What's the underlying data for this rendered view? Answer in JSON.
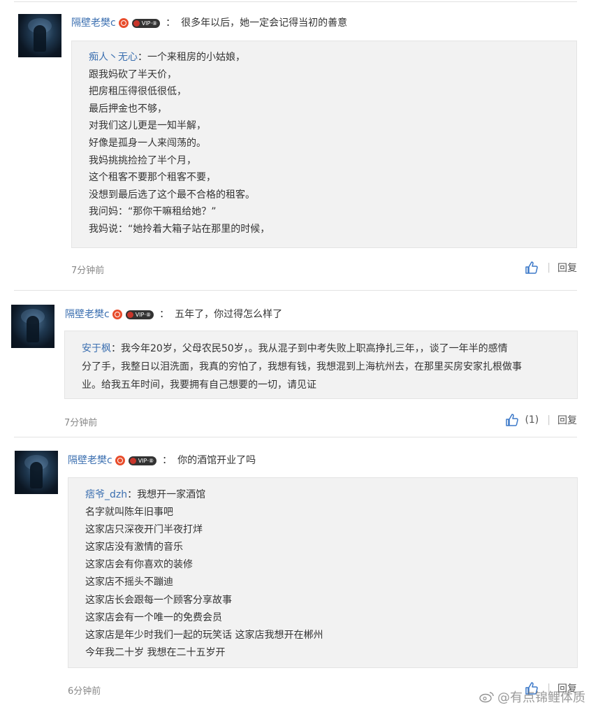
{
  "comments": [
    {
      "username": "隔壁老樊c",
      "vip_badge": "VIP·⑧",
      "colon": "：",
      "message": "很多年以后，她一定会记得当初的善意",
      "quote": {
        "username": "痴人丶无心",
        "colon": "：",
        "lines": [
          "一个来租房的小姑娘，",
          "跟我妈砍了半天价，",
          "把房租压得很低很低，",
          "最后押金也不够，",
          "对我们这儿更是一知半解，",
          "好像是孤身一人来闯荡的。",
          "我妈挑挑捡捡了半个月，",
          "这个租客不要那个租客不要，",
          "没想到最后选了这个最不合格的租客。",
          "我问妈：“那你干嘛租给她？”",
          "我妈说：“她拎着大箱子站在那里的时候，"
        ]
      },
      "time": "7分钟前",
      "reply": "回复"
    },
    {
      "username": "隔壁老樊c",
      "vip_badge": "VIP·⑧",
      "colon": "：",
      "message": "五年了，你过得怎么样了",
      "quote": {
        "username": "安于枫",
        "colon": "：",
        "lines": [
          "我今年20岁，父母农民50岁，。我从混子到中考失败上职高挣扎三年，，谈了一年半的感情",
          "分了手，我整日以泪洗面，我真的穷怕了，我想有钱，我想混到上海杭州去，在那里买房安家扎根做事",
          "业。给我五年时间，我要拥有自己想要的一切，请见证"
        ]
      },
      "time": "7分钟前",
      "like_count": "(1)",
      "reply": "回复"
    },
    {
      "username": "隔壁老樊c",
      "vip_badge": "VIP·⑧",
      "colon": "：",
      "message": "你的酒馆开业了吗",
      "quote": {
        "username": "痞爷_dzh",
        "colon": "：",
        "lines": [
          "我想开一家酒馆",
          "名字就叫陈年旧事吧",
          "这家店只深夜开门半夜打烊",
          "这家店没有激情的音乐",
          "这家店会有你喜欢的装修",
          "这家店不摇头不蹦迪",
          "这家店长会跟每一个顾客分享故事",
          "这家店会有一个唯一的免费会员",
          "这家店是年少时我们一起的玩笑话 这家店我想开在郴州",
          "今年我二十岁 我想在二十五岁开"
        ]
      },
      "time": "6分钟前",
      "reply": "回复"
    }
  ],
  "watermark": "@有点锦鲤体质",
  "colors": {
    "link": "#3b6fb0",
    "quote_bg": "#f2f2f2",
    "divider": "#e2e2e2",
    "like_icon": "#3b78c8"
  },
  "icons": [
    "like-icon",
    "weibo-icon"
  ]
}
